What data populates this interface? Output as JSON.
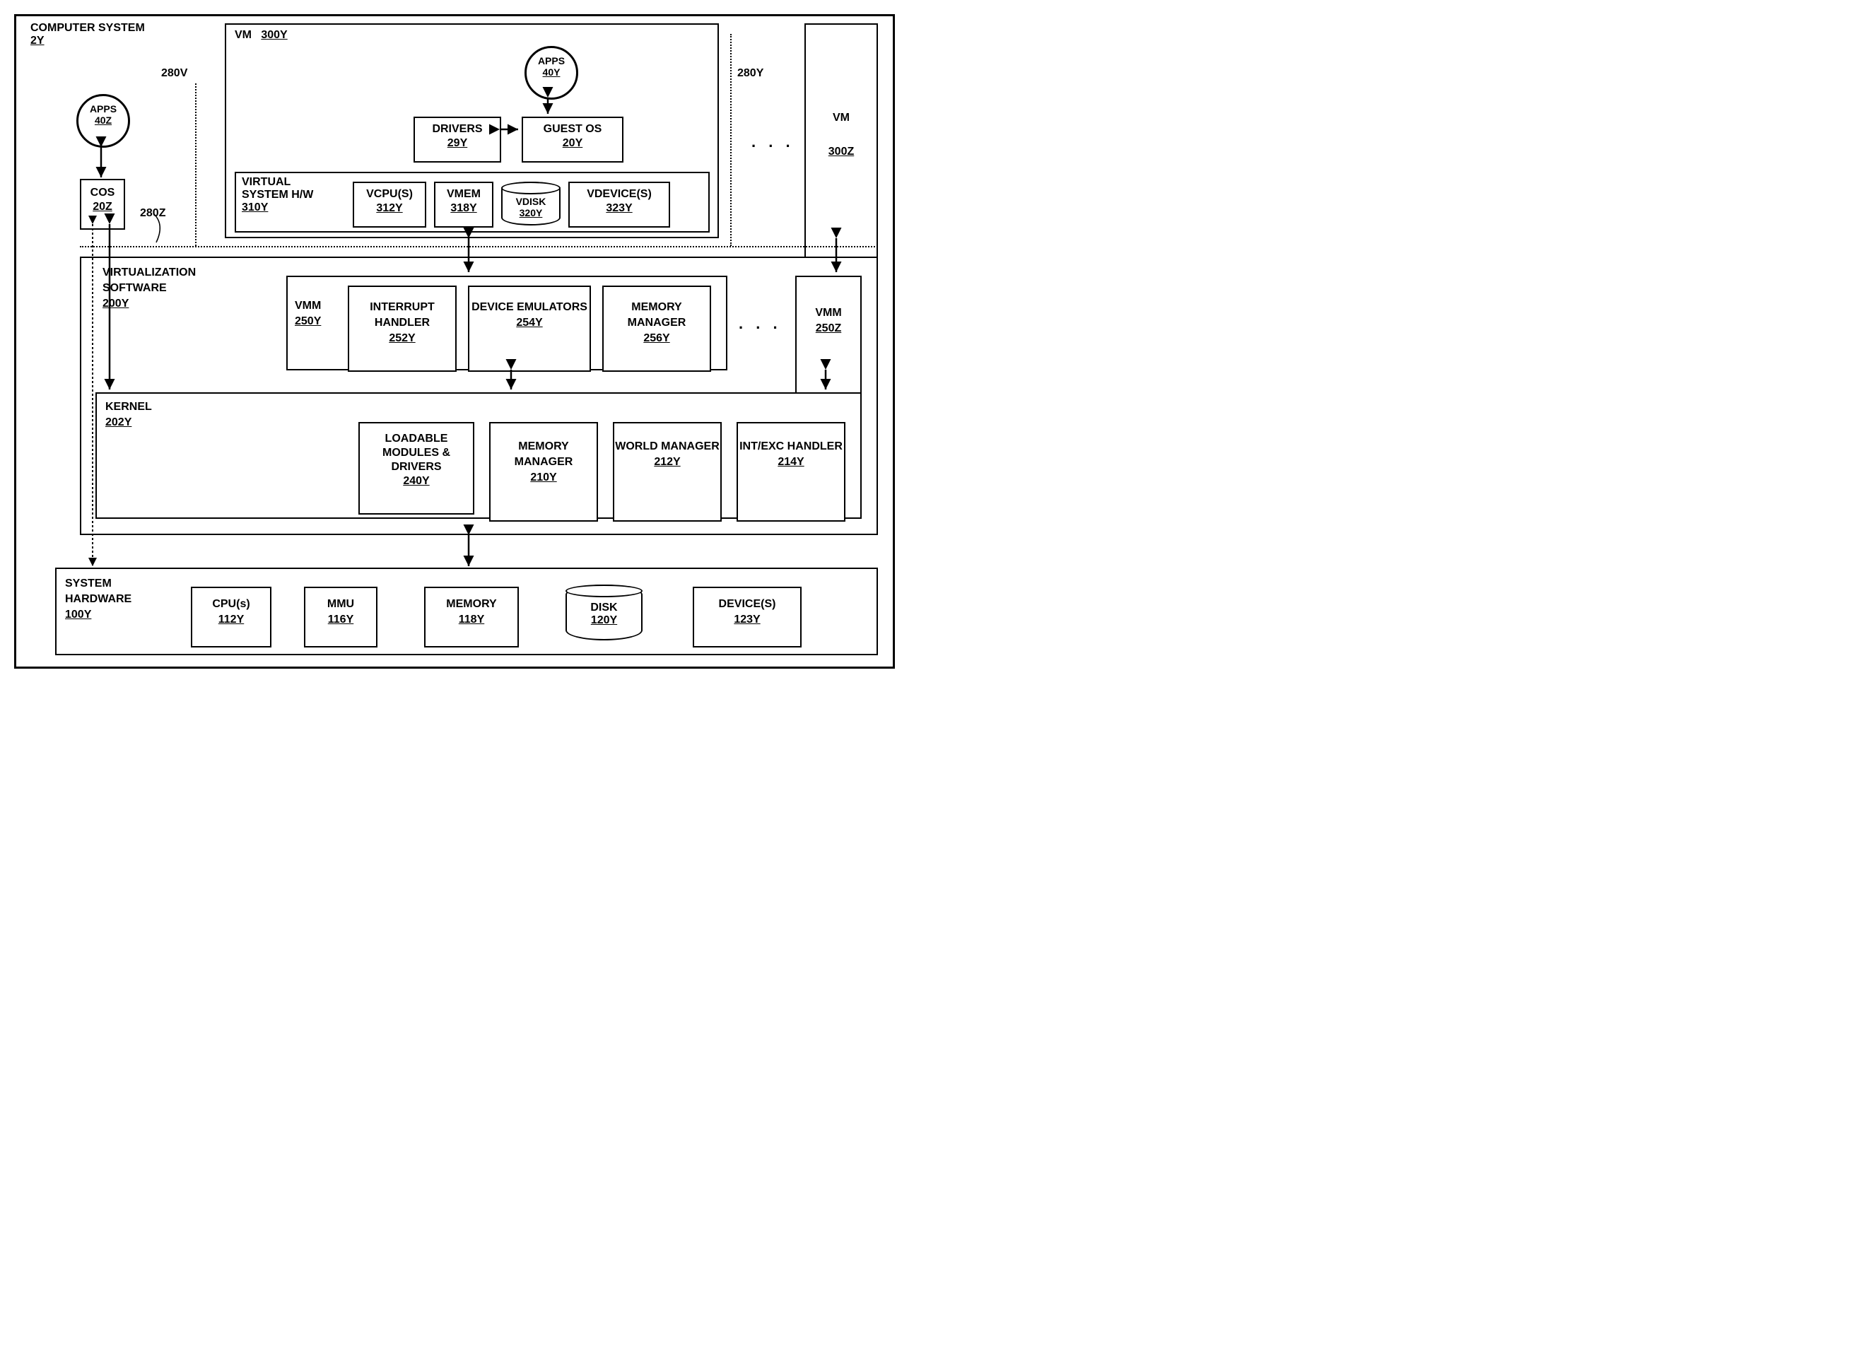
{
  "computer_system": {
    "title": "COMPUTER SYSTEM",
    "ref": "2Y"
  },
  "apps_z": {
    "title": "APPS",
    "ref": "40Z"
  },
  "cos": {
    "title": "COS",
    "ref": "20Z"
  },
  "p280v": "280V",
  "p280z": "280Z",
  "p280y": "280Y",
  "vm300y": {
    "title": "VM",
    "ref": "300Y"
  },
  "apps_y": {
    "title": "APPS",
    "ref": "40Y"
  },
  "drivers": {
    "title": "DRIVERS",
    "ref": "29Y"
  },
  "guest_os": {
    "title": "GUEST OS",
    "ref": "20Y"
  },
  "vshw": {
    "line1": "VIRTUAL",
    "line2": "SYSTEM H/W",
    "ref": "310Y"
  },
  "vcpu": {
    "title": "VCPU(S)",
    "ref": "312Y"
  },
  "vmem": {
    "title": "VMEM",
    "ref": "318Y"
  },
  "vdisk": {
    "title": "VDISK",
    "ref": "320Y"
  },
  "vdev": {
    "title": "VDEVICE(S)",
    "ref": "323Y"
  },
  "vm300z": {
    "title": "VM",
    "ref": "300Z"
  },
  "vsw": {
    "line1": "VIRTUALIZATION",
    "line2": "SOFTWARE",
    "ref": "200Y"
  },
  "vmm250y": {
    "title": "VMM",
    "ref": "250Y"
  },
  "ih": {
    "title": "INTERRUPT HANDLER",
    "ref": "252Y"
  },
  "de": {
    "title": "DEVICE EMULATORS",
    "ref": "254Y"
  },
  "mm1": {
    "title": "MEMORY MANAGER",
    "ref": "256Y"
  },
  "vmm250z": {
    "title": "VMM",
    "ref": "250Z"
  },
  "kernel": {
    "title": "KERNEL",
    "ref": "202Y"
  },
  "lmd": {
    "title": "LOADABLE MODULES & DRIVERS",
    "ref": "240Y"
  },
  "mm2": {
    "title": "MEMORY MANAGER",
    "ref": "210Y"
  },
  "wm": {
    "title": "WORLD MANAGER",
    "ref": "212Y"
  },
  "ieh": {
    "title": "INT/EXC HANDLER",
    "ref": "214Y"
  },
  "hw": {
    "line1": "SYSTEM",
    "line2": "HARDWARE",
    "ref": "100Y"
  },
  "cpu": {
    "title": "CPU(s)",
    "ref": "112Y"
  },
  "mmu": {
    "title": "MMU",
    "ref": "116Y"
  },
  "memory": {
    "title": "MEMORY",
    "ref": "118Y"
  },
  "disk": {
    "title": "DISK",
    "ref": "120Y"
  },
  "devices": {
    "title": "DEVICE(S)",
    "ref": "123Y"
  }
}
